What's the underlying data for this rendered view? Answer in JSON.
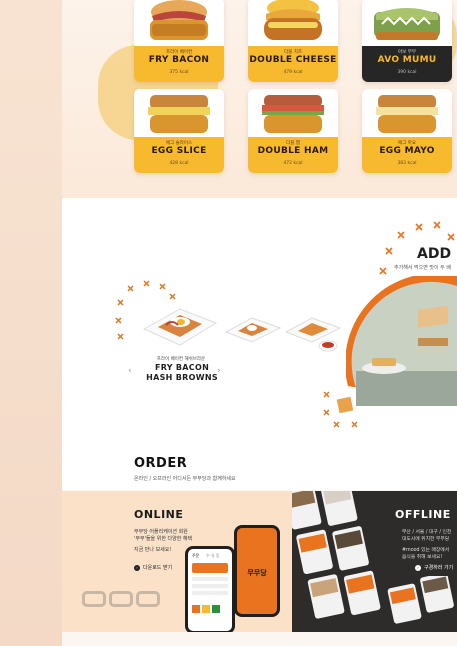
{
  "menu": {
    "cards": [
      {
        "sub": "프라이 베이컨",
        "name": "FRY BACON",
        "kcal": "375 kcal",
        "theme": "yellow"
      },
      {
        "sub": "더블 치즈",
        "name": "DOUBLE CHEESE",
        "kcal": "479 kcal",
        "theme": "yellow"
      },
      {
        "sub": "아보 무무",
        "name": "AVO MUMU",
        "kcal": "390 kcal",
        "theme": "dark"
      },
      {
        "sub": "에그 슬라이스",
        "name": "EGG SLICE",
        "kcal": "428 kcal",
        "theme": "yellow"
      },
      {
        "sub": "더블 햄",
        "name": "DOUBLE HAM",
        "kcal": "472 kcal",
        "theme": "yellow"
      },
      {
        "sub": "에그 마요",
        "name": "EGG MAYO",
        "kcal": "383 kcal",
        "theme": "yellow"
      }
    ]
  },
  "add": {
    "title": "ADD",
    "subtitle": "추가해서 먹으면 맛이 두 배",
    "featured_sub": "프라이 베이컨 해쉬브라운",
    "featured_name_line1": "FRY BACON",
    "featured_name_line2": "HASH BROWNS",
    "prev_icon": "chevron-left-icon",
    "next_icon": "chevron-right-icon"
  },
  "order": {
    "title": "ORDER",
    "subtitle": "온라인 / 오프라인 어디서든 무무당과 함께하세요"
  },
  "online": {
    "title": "ONLINE",
    "desc_line1": "무무당 어플리케이션 회원",
    "desc_line2": "'무무'들을 위한 다양한 혜택",
    "desc_line3": "지금 만나 보세요!",
    "download_label": "다운로드 받기",
    "app_brand": "무무당",
    "app_tab1": "주문",
    "app_tab2": "수 유 동"
  },
  "offline": {
    "title": "OFFLINE",
    "desc_line1": "부산 / 서울 / 대구 / 인천",
    "desc_line2": "대도시에 위치한 무무당",
    "desc_line3": "#mood 있는 매장에서",
    "desc_line4": "음식을 취해 보세요!",
    "link_label": "구경하러 가기"
  },
  "colors": {
    "accent_orange": "#e9731f",
    "yellow": "#f7b92d",
    "dark": "#262626"
  }
}
